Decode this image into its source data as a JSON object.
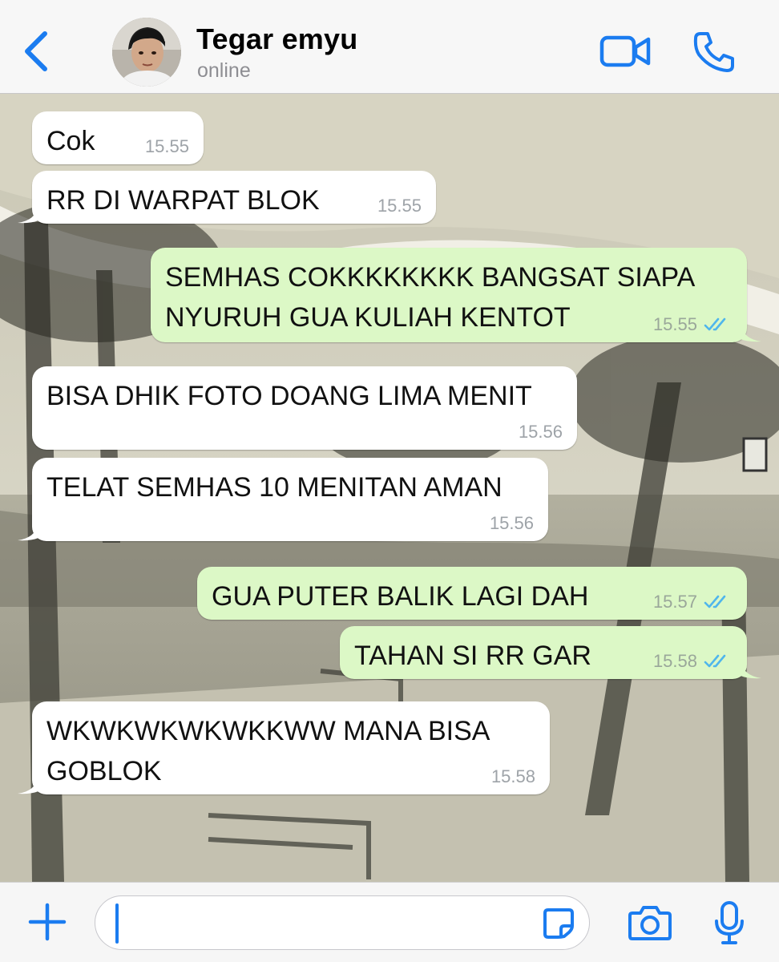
{
  "header": {
    "contact_name": "Tegar emyu",
    "status": "online"
  },
  "messages": [
    {
      "direction": "in",
      "text": "Cok",
      "time": "15.55"
    },
    {
      "direction": "in",
      "text": "RR DI WARPAT BLOK",
      "time": "15.55"
    },
    {
      "direction": "out",
      "text": "SEMHAS COKKKKKKKK BANGSAT SIAPA NYURUH GUA KULIAH KENTOT",
      "time": "15.55",
      "status": "read"
    },
    {
      "direction": "in",
      "text": "BISA DHIK FOTO DOANG LIMA MENIT",
      "time": "15.56"
    },
    {
      "direction": "in",
      "text": "TELAT SEMHAS 10 MENITAN AMAN",
      "time": "15.56"
    },
    {
      "direction": "out",
      "text": "GUA PUTER BALIK LAGI DAH",
      "time": "15.57",
      "status": "read"
    },
    {
      "direction": "out",
      "text": "TAHAN SI RR GAR",
      "time": "15.58",
      "status": "read"
    },
    {
      "direction": "in",
      "text": "WKWKWKWKWKKWW MANA BISA GOBLOK",
      "time": "15.58"
    }
  ],
  "composer": {
    "value": "",
    "placeholder": ""
  },
  "colors": {
    "accent": "#1b7cf0",
    "incoming_bubble": "#ffffff",
    "outgoing_bubble": "#dcf8c6",
    "read_ticks": "#4fb6ec"
  }
}
